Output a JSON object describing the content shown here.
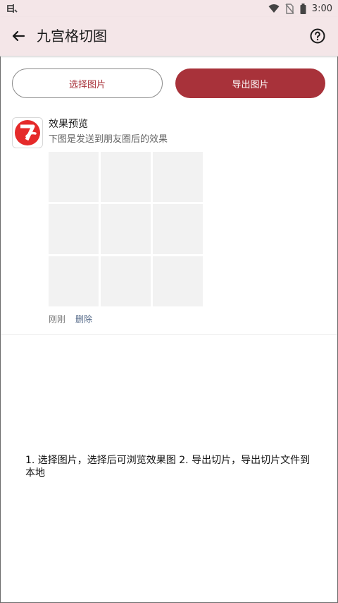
{
  "status_bar": {
    "time": "3:00",
    "icons": [
      "app-notification-icon",
      "wifi-icon",
      "no-sim-icon",
      "battery-icon"
    ]
  },
  "app_bar": {
    "title": "九宫格切图",
    "icons": [
      "back-arrow-icon",
      "help-icon"
    ]
  },
  "actions": {
    "select_label": "选择图片",
    "export_label": "导出图片"
  },
  "preview": {
    "title": "效果预览",
    "subtitle": "下图是发送到朋友圈后的效果",
    "time": "刚刚",
    "delete_label": "删除",
    "grid_cells": 9
  },
  "instructions": "1. 选择图片，选择后可浏览效果图 2. 导出切片，导出切片文件到本地",
  "colors": {
    "accent": "#a8323a",
    "app_bar_bg": "#f4e6e8",
    "grid_cell": "#f2f2f2",
    "link": "#566b8a"
  }
}
